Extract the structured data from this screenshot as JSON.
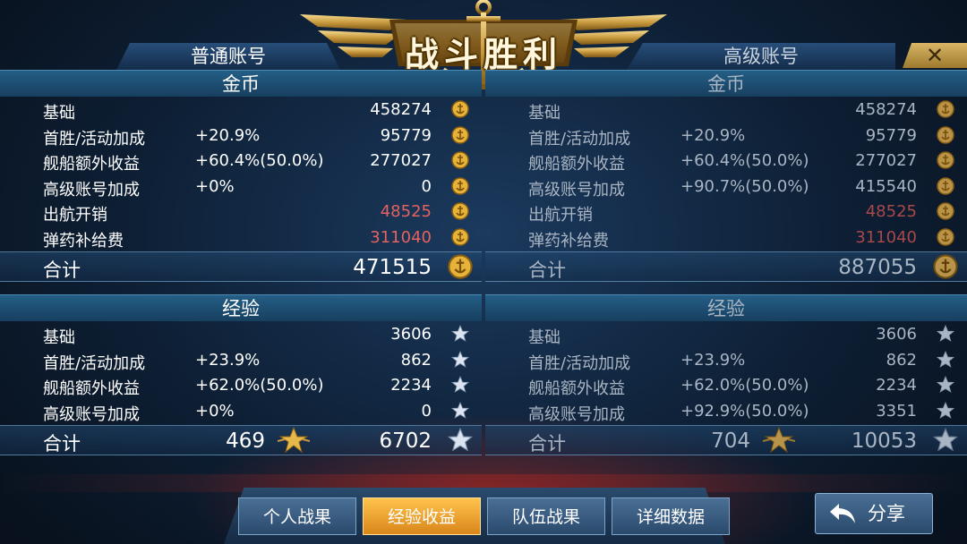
{
  "banner": {
    "title": "战斗胜利"
  },
  "accounts": {
    "normal": "普通账号",
    "premium": "高级账号"
  },
  "close_symbol": "✕",
  "colors": {
    "gold": "#e8c16a",
    "negative": "#e4625f",
    "active_tab": "#ffb940"
  },
  "left": {
    "coins": {
      "header": "金币",
      "rows": [
        {
          "label": "基础",
          "bonus": "",
          "value": "458274",
          "neg": false
        },
        {
          "label": "首胜/活动加成",
          "bonus": "+20.9%",
          "value": "95779",
          "neg": false
        },
        {
          "label": "舰船额外收益",
          "bonus": "+60.4%(50.0%)",
          "value": "277027",
          "neg": false
        },
        {
          "label": "高级账号加成",
          "bonus": "+0%",
          "value": "0",
          "neg": false
        },
        {
          "label": "出航开销",
          "bonus": "",
          "value": "48525",
          "neg": true
        },
        {
          "label": "弹药补给费",
          "bonus": "",
          "value": "311040",
          "neg": true
        }
      ],
      "total_label": "合计",
      "total": "471515"
    },
    "exp": {
      "header": "经验",
      "rows": [
        {
          "label": "基础",
          "bonus": "",
          "value": "3606"
        },
        {
          "label": "首胜/活动加成",
          "bonus": "+23.9%",
          "value": "862"
        },
        {
          "label": "舰船额外收益",
          "bonus": "+62.0%(50.0%)",
          "value": "2234"
        },
        {
          "label": "高级账号加成",
          "bonus": "+0%",
          "value": "0"
        }
      ],
      "total_label": "合计",
      "level_points": "469",
      "total": "6702"
    }
  },
  "right": {
    "coins": {
      "header": "金币",
      "rows": [
        {
          "label": "基础",
          "bonus": "",
          "value": "458274",
          "neg": false
        },
        {
          "label": "首胜/活动加成",
          "bonus": "+20.9%",
          "value": "95779",
          "neg": false
        },
        {
          "label": "舰船额外收益",
          "bonus": "+60.4%(50.0%)",
          "value": "277027",
          "neg": false
        },
        {
          "label": "高级账号加成",
          "bonus": "+90.7%(50.0%)",
          "value": "415540",
          "neg": false
        },
        {
          "label": "出航开销",
          "bonus": "",
          "value": "48525",
          "neg": true
        },
        {
          "label": "弹药补给费",
          "bonus": "",
          "value": "311040",
          "neg": true
        }
      ],
      "total_label": "合计",
      "total": "887055"
    },
    "exp": {
      "header": "经验",
      "rows": [
        {
          "label": "基础",
          "bonus": "",
          "value": "3606"
        },
        {
          "label": "首胜/活动加成",
          "bonus": "+23.9%",
          "value": "862"
        },
        {
          "label": "舰船额外收益",
          "bonus": "+62.0%(50.0%)",
          "value": "2234"
        },
        {
          "label": "高级账号加成",
          "bonus": "+92.9%(50.0%)",
          "value": "3351"
        }
      ],
      "total_label": "合计",
      "level_points": "704",
      "total": "10053"
    }
  },
  "tabs": [
    {
      "label": "个人战果",
      "active": false
    },
    {
      "label": "经验收益",
      "active": true
    },
    {
      "label": "队伍战果",
      "active": false
    },
    {
      "label": "详细数据",
      "active": false
    }
  ],
  "share": {
    "label": "分享",
    "icon": "back-arrow-icon"
  }
}
